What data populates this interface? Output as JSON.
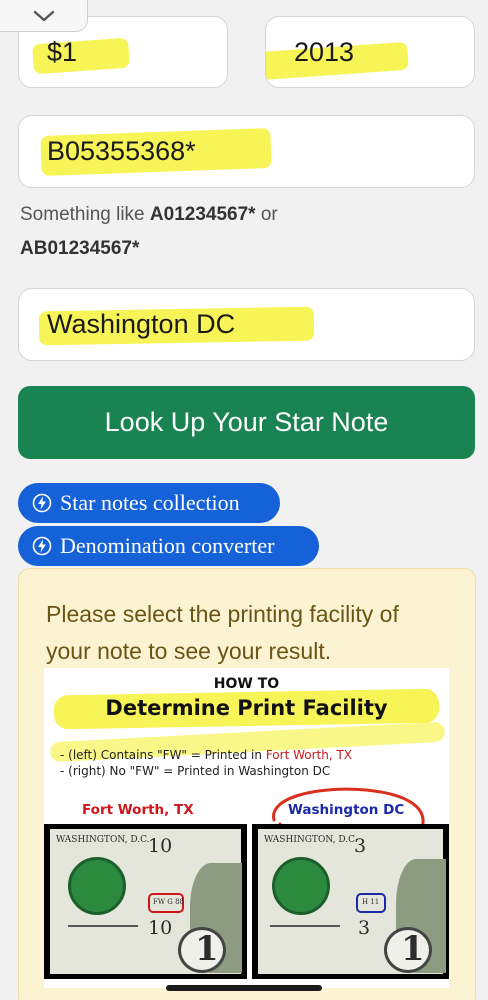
{
  "form": {
    "denomination": "$1",
    "year": "2013",
    "serial": "B05355368*",
    "hint_prefix": "Something like ",
    "hint_example_1": "A01234567*",
    "hint_or": " or ",
    "hint_example_2": "AB01234567*",
    "facility": "Washington DC",
    "lookup_label": "Look Up Your Star Note"
  },
  "links": {
    "star_notes": "Star notes collection",
    "denomination_converter": "Denomination converter"
  },
  "result": {
    "message": "Please select the printing facility of your note to see your result."
  },
  "facility_image": {
    "how_to": "HOW TO",
    "title": "Determine Print Facility",
    "line1_prefix": "- (left) Contains \"FW\" = Printed in ",
    "line1_city": "Fort Worth, TX",
    "line2": "- (right) No \"FW\" = Printed in Washington DC",
    "label_left": "Fort Worth, TX",
    "label_right": "Washington DC",
    "bill_left_header": "WASHINGTON, D.C.",
    "bill_left_number": "10",
    "bill_left_mark": "FW G 88",
    "bill_right_header": "WASHINGTON, D.C.",
    "bill_right_number": "3",
    "bill_right_mark": "H 11"
  },
  "colors": {
    "green_button": "#198351",
    "pill_blue": "#1461d8",
    "panel_bg": "#fcf3d2",
    "panel_text": "#6b5516",
    "highlight": "#f6f23a",
    "fort_worth_red": "#d0161b",
    "washington_blue": "#1a2aa8"
  },
  "icons": {
    "collapse": "chevron-down-icon",
    "pill": "lightning-bolt-icon"
  }
}
